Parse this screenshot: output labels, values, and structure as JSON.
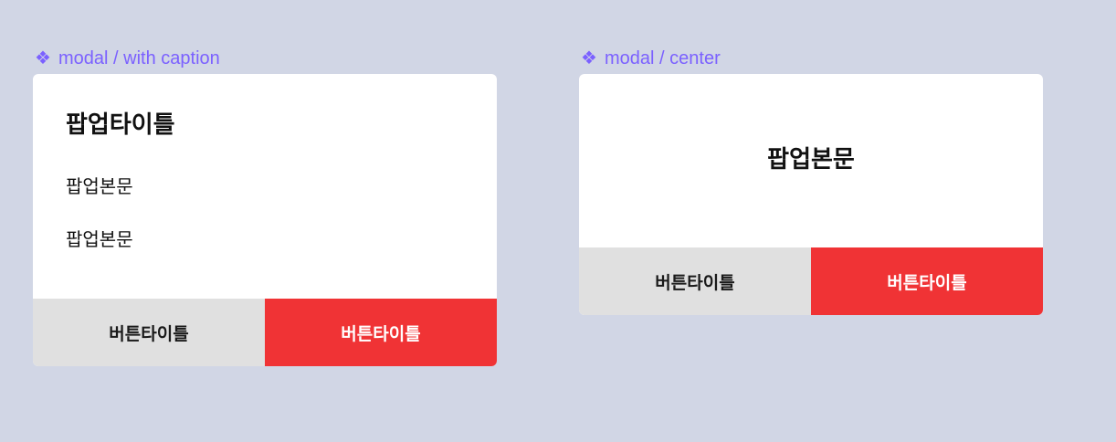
{
  "colors": {
    "canvas_background": "#d1d6e5",
    "component_label": "#7b61ff",
    "modal_background": "#ffffff",
    "secondary_button": "#e0e0e0",
    "primary_button": "#f03335"
  },
  "modal_caption": {
    "component_label": "modal / with caption",
    "component_icon": "❖",
    "title": "팝업타이틀",
    "body_lines": [
      "팝업본문",
      "팝업본문"
    ],
    "secondary_button": "버튼타이틀",
    "primary_button": "버튼타이틀"
  },
  "modal_center": {
    "component_label": "modal / center",
    "component_icon": "❖",
    "body": "팝업본문",
    "secondary_button": "버튼타이틀",
    "primary_button": "버튼타이틀"
  }
}
